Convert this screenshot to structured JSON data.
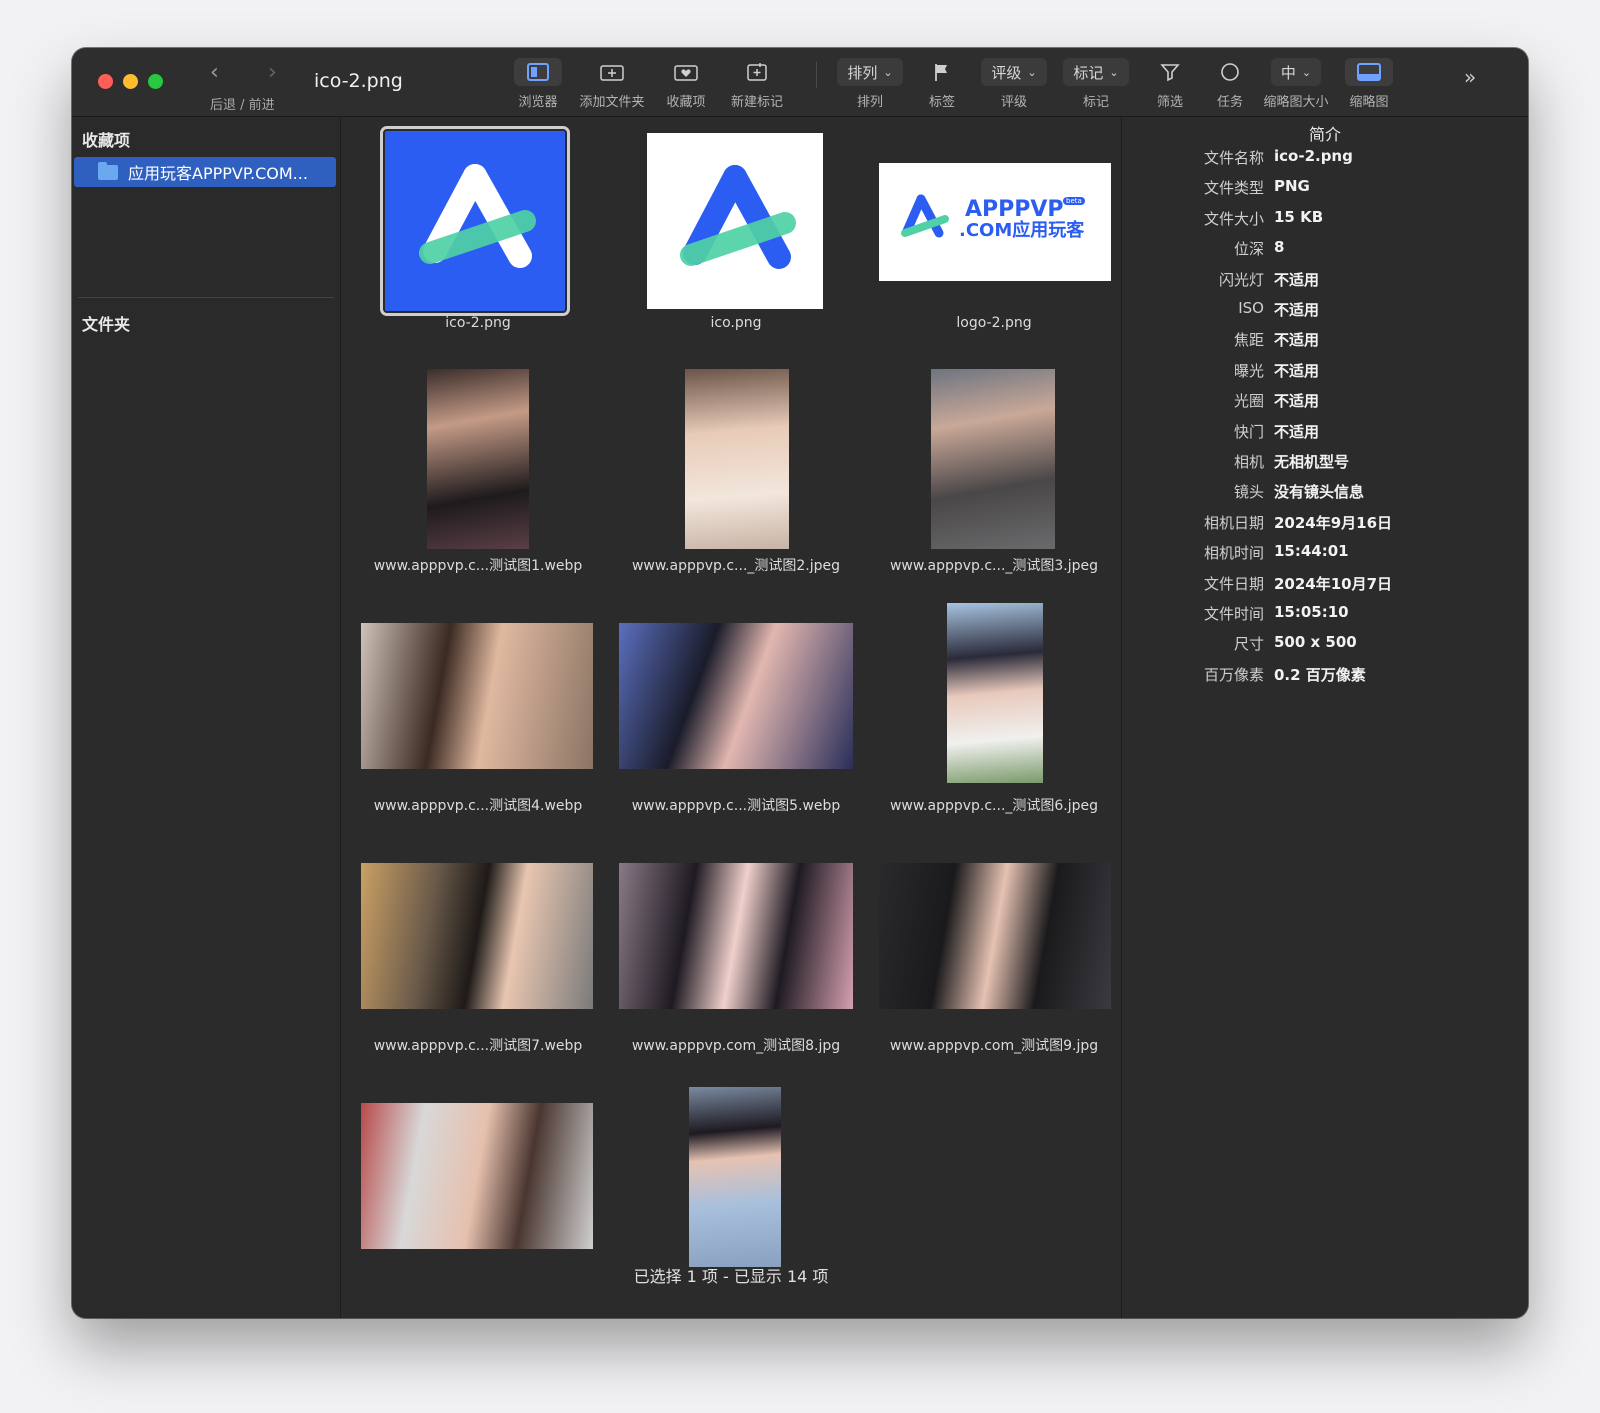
{
  "window": {
    "title": "ico-2.png",
    "nav_label": "后退 / 前进"
  },
  "toolbar": {
    "browser": "浏览器",
    "add_folder": "添加文件夹",
    "favorites": "收藏项",
    "new_mark": "新建标记",
    "sort_pill": "排列",
    "sort": "排列",
    "tags": "标签",
    "rating_pill": "评级",
    "rating": "评级",
    "mark_pill": "标记",
    "mark": "标记",
    "filter": "筛选",
    "tasks": "任务",
    "thumb_size_pill": "中",
    "thumb_size": "缩略图大小",
    "thumbnails": "缩略图"
  },
  "sidebar": {
    "favorites_header": "收藏项",
    "favorite_item": "应用玩客APPPVP.COM...",
    "folders_header": "文件夹"
  },
  "grid": {
    "items": [
      {
        "label": "ico-2.png"
      },
      {
        "label": "ico.png"
      },
      {
        "label": "logo-2.png"
      },
      {
        "label": "www.apppvp.c...测试图1.webp"
      },
      {
        "label": "www.apppvp.c..._测试图2.jpeg"
      },
      {
        "label": "www.apppvp.c..._测试图3.jpeg"
      },
      {
        "label": "www.apppvp.c...测试图4.webp"
      },
      {
        "label": "www.apppvp.c...测试图5.webp"
      },
      {
        "label": "www.apppvp.c..._测试图6.jpeg"
      },
      {
        "label": "www.apppvp.c...测试图7.webp"
      },
      {
        "label": "www.apppvp.com_测试图8.jpg"
      },
      {
        "label": "www.apppvp.com_测试图9.jpg"
      }
    ],
    "logo_text_1": "APPPVP",
    "logo_text_2": ".COM应用玩客",
    "logo_badge": "beta",
    "status": "已选择 1 项 - 已显示 14 项"
  },
  "info": {
    "title": "简介",
    "rows": [
      {
        "key": "文件名称",
        "value": "ico-2.png"
      },
      {
        "key": "文件类型",
        "value": "PNG"
      },
      {
        "key": "文件大小",
        "value": "15 KB"
      },
      {
        "key": "位深",
        "value": "8"
      },
      {
        "key": "闪光灯",
        "value": "不适用"
      },
      {
        "key": "ISO",
        "value": "不适用"
      },
      {
        "key": "焦距",
        "value": "不适用"
      },
      {
        "key": "曝光",
        "value": "不适用"
      },
      {
        "key": "光圈",
        "value": "不适用"
      },
      {
        "key": "快门",
        "value": "不适用"
      },
      {
        "key": "相机",
        "value": "无相机型号"
      },
      {
        "key": "镜头",
        "value": "没有镜头信息"
      },
      {
        "key": "相机日期",
        "value": "2024年9月16日"
      },
      {
        "key": "相机时间",
        "value": "15:44:01"
      },
      {
        "key": "文件日期",
        "value": "2024年10月7日"
      },
      {
        "key": "文件时间",
        "value": "15:05:10"
      },
      {
        "key": "尺寸",
        "value": "500 x 500"
      },
      {
        "key": "百万像素",
        "value": "0.2 百万像素"
      }
    ]
  },
  "colors": {
    "accent_blue": "#2b5df2",
    "sidebar_selection": "#2f5fbf",
    "logo_green": "#4fd1a5"
  }
}
